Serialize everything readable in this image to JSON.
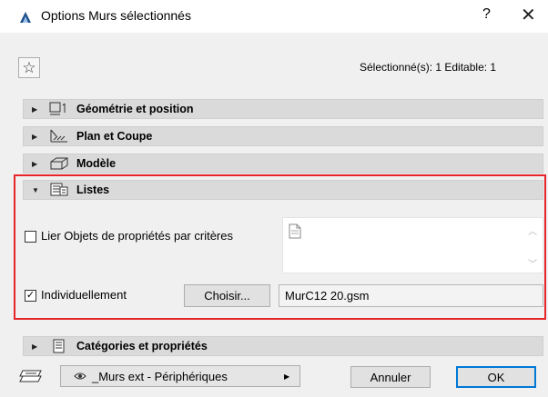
{
  "window": {
    "title": "Options Murs sélectionnés",
    "help": "?",
    "close": "✕"
  },
  "header": {
    "selection_info": "Sélectionné(s): 1 Editable: 1"
  },
  "sections": {
    "geometry": "Géométrie et position",
    "plan": "Plan et Coupe",
    "model": "Modèle",
    "lists": "Listes",
    "categories": "Catégories et propriétés"
  },
  "lists": {
    "link_label": "Lier Objets de propriétés par critères",
    "link_checked": false,
    "individual_label": "Individuellement",
    "individual_checked": true,
    "choose_button": "Choisir...",
    "file_value": "MurC12 20.gsm"
  },
  "footer": {
    "favorite_name": "_Murs ext - Périphériques",
    "cancel_button": "Annuler",
    "ok_button": "OK"
  },
  "colors": {
    "highlight_border": "#e5252a",
    "ok_border": "#0078d7",
    "app_icon": "#1c4f8c"
  },
  "icons": [
    "app-icon",
    "star-icon",
    "geometry-icon",
    "plan-section-icon",
    "model-icon",
    "lists-icon",
    "categories-icon",
    "favorite-icon",
    "eye-icon"
  ]
}
